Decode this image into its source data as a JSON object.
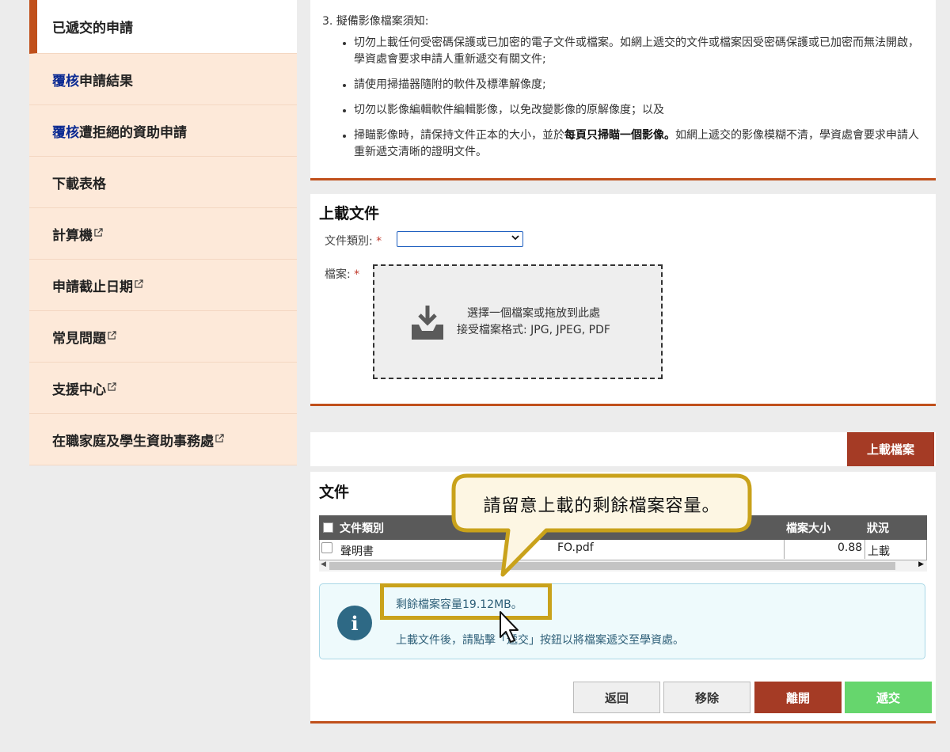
{
  "sidebar": {
    "items": [
      {
        "label": "已遞交的申請",
        "prefix": ""
      },
      {
        "label": "申請結果",
        "prefix": "覆核"
      },
      {
        "label": "遭拒絕的資助申請",
        "prefix": "覆核"
      },
      {
        "label": "下載表格",
        "prefix": ""
      },
      {
        "label": "計算機",
        "prefix": ""
      },
      {
        "label": "申請截止日期",
        "prefix": ""
      },
      {
        "label": "常見問題",
        "prefix": ""
      },
      {
        "label": "支援中心",
        "prefix": ""
      },
      {
        "label": "在職家庭及學生資助事務處",
        "prefix": ""
      }
    ]
  },
  "notes": {
    "heading": "3. 擬備影像檔案須知:",
    "b1": "切勿上載任何受密碼保護或已加密的電子文件或檔案。如網上遞交的文件或檔案因受密碼保護或已加密而無法開啟，學資處會要求申請人重新遞交有關文件;",
    "b2": "請使用掃描器隨附的軟件及標準解像度;",
    "b3": "切勿以影像編輯軟件編輯影像，以免改變影像的原解像度；以及",
    "b4_pre": "掃瞄影像時，請保持文件正本的大小，並於",
    "b4_bold": "每頁只掃瞄一個影像。",
    "b4_post": "如網上遞交的影像模糊不清，學資處會要求申請人重新遞交清晰的證明文件。"
  },
  "upload": {
    "title": "上載文件",
    "type_label": "文件類別:",
    "file_label": "檔案:",
    "required_mark": "*",
    "select_value": "",
    "drop_line1": "選擇一個檔案或拖放到此處",
    "drop_line2": "接受檔案格式: JPG, JPEG, PDF",
    "upload_button": "上載檔案"
  },
  "documents": {
    "title": "文件",
    "columns": [
      "文件類別",
      "檔案大小",
      "狀況"
    ],
    "rows": [
      {
        "type": "聲明書",
        "file": "FO.pdf",
        "size": "0.88",
        "status": "上載"
      }
    ],
    "info_line1": "剩餘檔案容量19.12MB。",
    "info_line2": "上載文件後，請點擊「遞交」按鈕以將檔案遞交至學資處。",
    "info_icon": "i"
  },
  "buttons": {
    "back": "返回",
    "remove": "移除",
    "leave": "離開",
    "submit": "遞交"
  },
  "tooltip": {
    "text": "請留意上載的剩餘檔案容量。"
  },
  "colors": {
    "accent": "#c0501b",
    "sidebar_bg": "#fde9d9",
    "leave_button": "#a53b25",
    "submit_button": "#66d66d",
    "info_bg": "#eefafc",
    "highlight": "#c9a21b"
  }
}
